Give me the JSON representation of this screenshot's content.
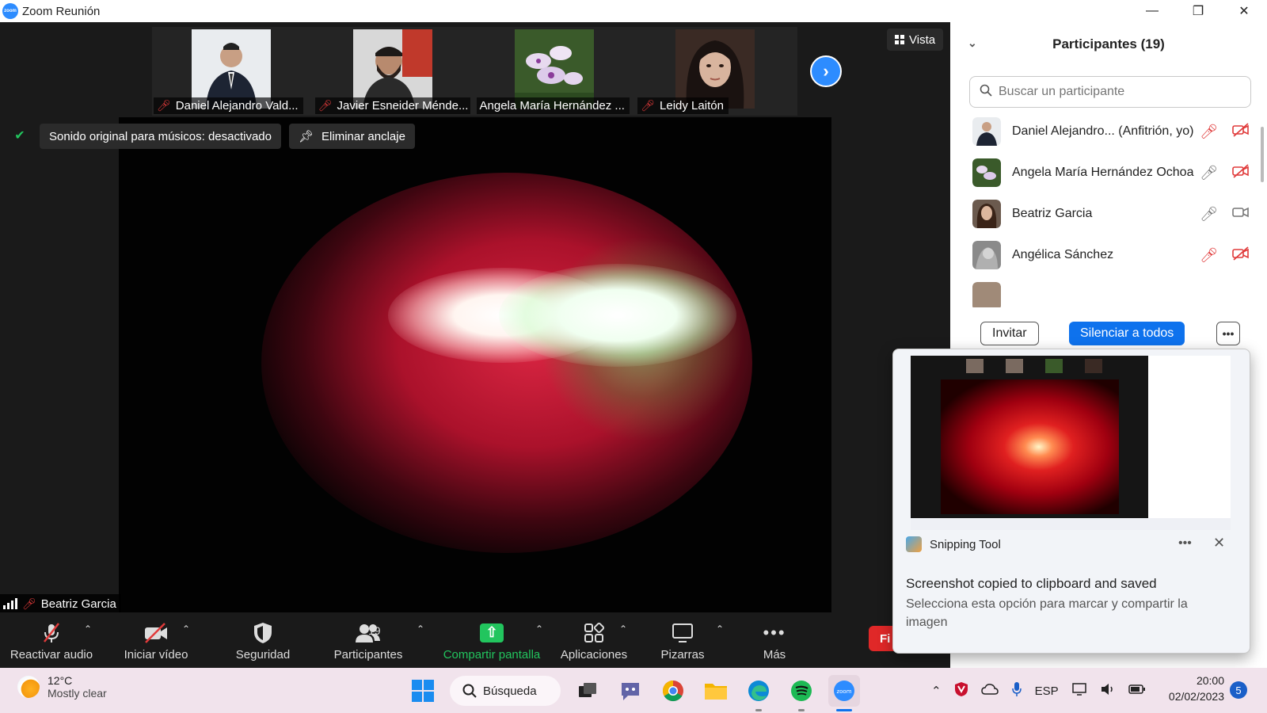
{
  "window": {
    "title": "Zoom Reunión",
    "logo_text": "zoom"
  },
  "gallery": {
    "thumbnails": [
      {
        "name": "Daniel Alejandro Vald...",
        "muted": true
      },
      {
        "name": "Javier Esneider Ménde...",
        "muted": true
      },
      {
        "name": "Angela María Hernández ...",
        "muted": false
      },
      {
        "name": "Leidy Laitón",
        "muted": true
      }
    ],
    "view_label": "Vista"
  },
  "meeting": {
    "audio_notice": "Sonido original para músicos: desactivado",
    "unpin_label": "Eliminar anclaje",
    "speaker_name": "Beatriz Garcia"
  },
  "toolbar": {
    "unmute": "Reactivar audio",
    "start_video": "Iniciar vídeo",
    "security": "Seguridad",
    "participants": "Participantes",
    "participants_count": "19",
    "share": "Compartir pantalla",
    "apps": "Aplicaciones",
    "whiteboards": "Pizarras",
    "more": "Más",
    "end_partial": "Fi"
  },
  "panel": {
    "title": "Participantes (19)",
    "search_placeholder": "Buscar un participante",
    "participants": [
      {
        "name": "Daniel Alejandro... (Anfitrión, yo)",
        "mic": "muted",
        "video": "off"
      },
      {
        "name": "Angela María Hernández Ochoa",
        "mic": "on",
        "video": "off"
      },
      {
        "name": "Beatriz Garcia",
        "mic": "on",
        "video": "on"
      },
      {
        "name": "Angélica Sánchez",
        "mic": "muted",
        "video": "off"
      }
    ],
    "invite": "Invitar",
    "mute_all": "Silenciar a todos"
  },
  "toast": {
    "app_name": "Snipping Tool",
    "title": "Screenshot copied to clipboard and saved",
    "body": "Selecciona esta opción para marcar y compartir la imagen"
  },
  "taskbar": {
    "temperature": "12°C",
    "condition": "Mostly clear",
    "search_label": "Búsqueda",
    "language": "ESP",
    "time": "20:00",
    "date": "02/02/2023",
    "notification_count": "5"
  }
}
